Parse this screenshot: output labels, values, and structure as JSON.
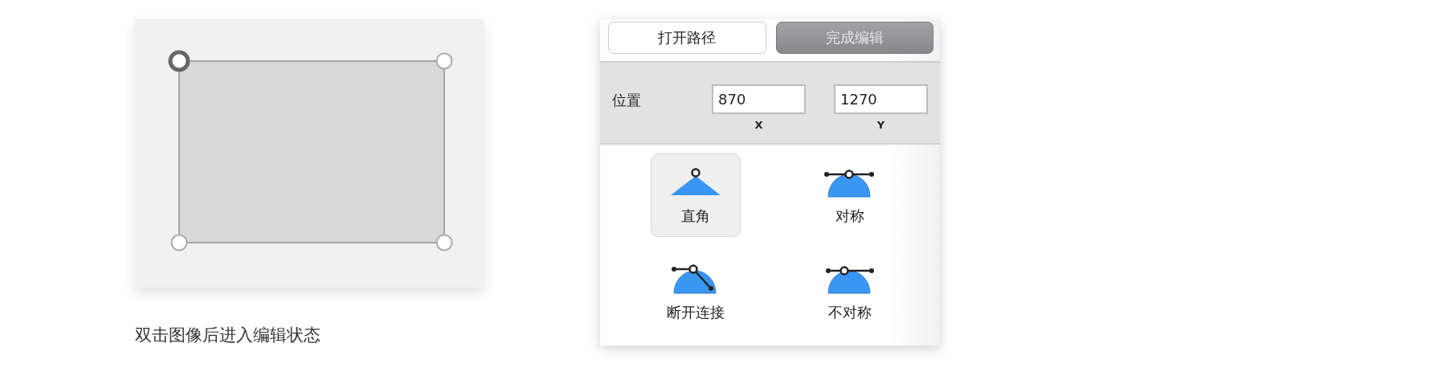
{
  "canvas": {
    "handles": [
      {
        "selected": true
      },
      {
        "selected": false
      },
      {
        "selected": false
      },
      {
        "selected": false
      }
    ],
    "caption": "双击图像后进入编辑状态"
  },
  "panel": {
    "buttons": [
      {
        "label": "打开路径",
        "kind": "plain"
      },
      {
        "label": "完成编辑",
        "kind": "dark"
      }
    ],
    "position": {
      "label": "位置",
      "fields": [
        {
          "value": "870",
          "axis": "X"
        },
        {
          "value": "1270",
          "axis": "Y"
        }
      ]
    },
    "modes": [
      {
        "label": "直角",
        "kind": "corner",
        "selected": true
      },
      {
        "label": "对称",
        "kind": "symmetric",
        "selected": false
      },
      {
        "label": "断开连接",
        "kind": "disconnected",
        "selected": false
      },
      {
        "label": "不对称",
        "kind": "asymmetric",
        "selected": false
      }
    ]
  }
}
